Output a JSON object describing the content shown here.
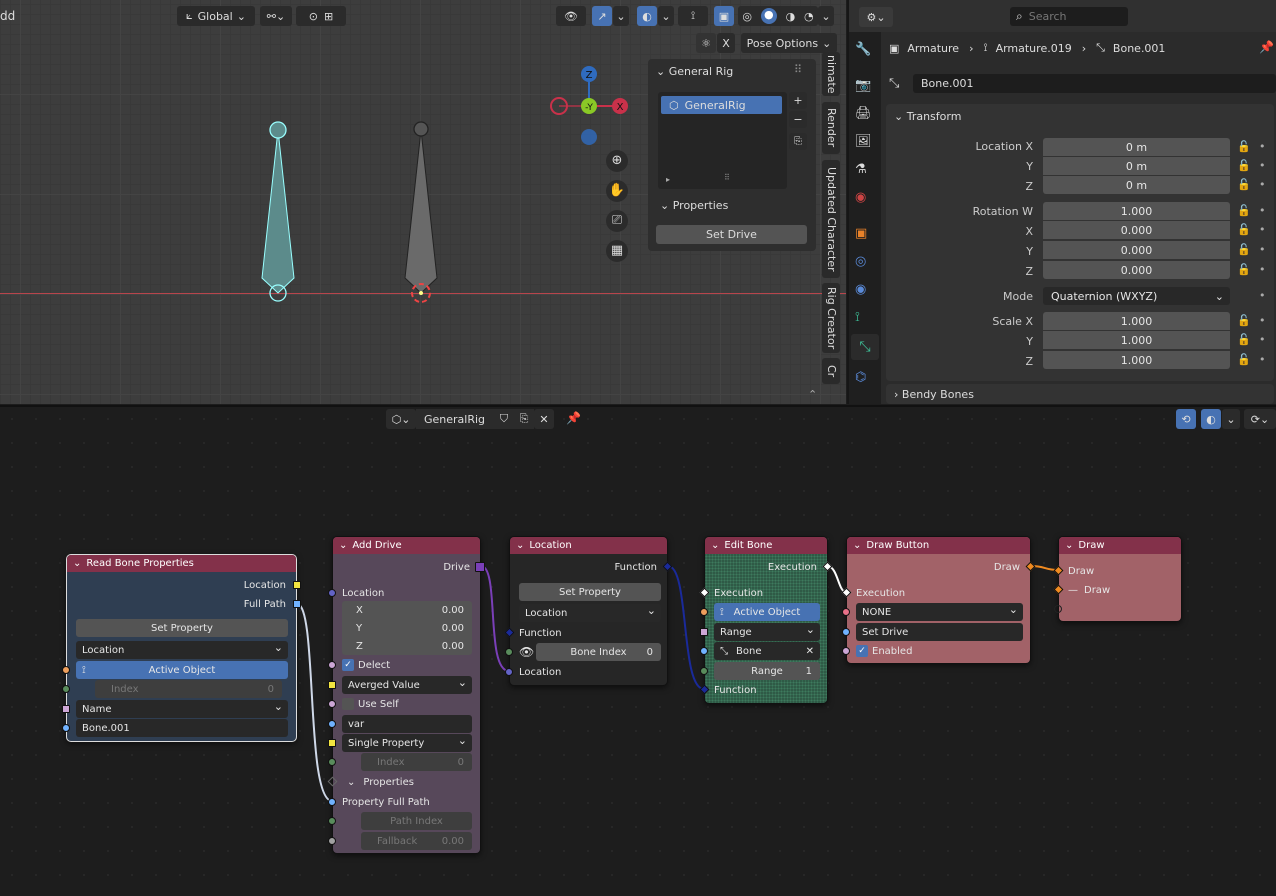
{
  "viewport": {
    "header": {
      "add_menu": "dd",
      "orientation": "Global",
      "pose_options": "Pose Options"
    },
    "side_tabs": [
      "nimate",
      "Render",
      "Updated Character",
      "Rig Creator",
      "Cr"
    ],
    "gizmo": {
      "z": "Z",
      "y": "-Y",
      "x": "X"
    },
    "npanel": {
      "title": "General Rig",
      "list_item": "GeneralRig",
      "properties": "Properties",
      "set_drive": "Set Drive"
    }
  },
  "properties": {
    "search_placeholder": "Search",
    "breadcrumb": [
      "Armature",
      "Armature.019",
      "Bone.001"
    ],
    "bone_name": "Bone.001",
    "transform_title": "Transform",
    "location": {
      "x_label": "Location X",
      "y_label": "Y",
      "z_label": "Z",
      "x": "0 m",
      "y": "0 m",
      "z": "0 m"
    },
    "rotation": {
      "w_label": "Rotation W",
      "x_label": "X",
      "y_label": "Y",
      "z_label": "Z",
      "w": "1.000",
      "x": "0.000",
      "y": "0.000",
      "z": "0.000"
    },
    "mode": {
      "label": "Mode",
      "value": "Quaternion (WXYZ)"
    },
    "scale": {
      "x_label": "Scale X",
      "y_label": "Y",
      "z_label": "Z",
      "x": "1.000",
      "y": "1.000",
      "z": "1.000"
    },
    "bendy_bones": "Bendy Bones"
  },
  "node_editor": {
    "tree_name": "GeneralRig",
    "nodes": {
      "read_bone": {
        "title": "Read Bone Properties",
        "out_location": "Location",
        "out_full_path": "Full Path",
        "set_property": "Set Property",
        "location_dd": "Location",
        "active_object": "Active Object",
        "index": "Index",
        "index_val": "0",
        "name_dd": "Name",
        "bone_name": "Bone.001"
      },
      "add_drive": {
        "title": "Add Drive",
        "out_drive": "Drive",
        "location": "Location",
        "x": "X",
        "y": "Y",
        "z": "Z",
        "x_val": "0.00",
        "y_val": "0.00",
        "z_val": "0.00",
        "delect": "Delect",
        "averaged": "Averged Value",
        "use_self": "Use Self",
        "var": "var",
        "single_prop": "Single Property",
        "index": "Index",
        "index_val": "0",
        "properties": "Properties",
        "prop_full_path": "Property Full Path",
        "path_index": "Path Index",
        "fallback": "Fallback",
        "fallback_val": "0.00"
      },
      "location": {
        "title": "Location",
        "out_function": "Function",
        "set_property": "Set Property",
        "location_dd": "Location",
        "function": "Function",
        "bone_index": "Bone Index",
        "bone_index_val": "0",
        "location": "Location"
      },
      "edit_bone": {
        "title": "Edit Bone",
        "out_execution": "Execution",
        "execution": "Execution",
        "active_object": "Active Object",
        "range_dd": "Range",
        "bone": "Bone",
        "range": "Range",
        "range_val": "1",
        "function": "Function"
      },
      "draw_button": {
        "title": "Draw Button",
        "out_draw": "Draw",
        "execution": "Execution",
        "none_dd": "NONE",
        "set_drive": "Set Drive",
        "enabled": "Enabled"
      },
      "draw": {
        "title": "Draw",
        "in_draw": "Draw",
        "in_draw2": "Draw"
      }
    }
  },
  "colors": {
    "accent": "#4772b3",
    "node_header": "#83314a",
    "socket_float": "#a1a1a1",
    "socket_vector": "#6363c7",
    "socket_string": "#70b2ff",
    "socket_object": "#ed9e5c",
    "socket_bool": "#cca6d6",
    "socket_int": "#598c5c"
  }
}
